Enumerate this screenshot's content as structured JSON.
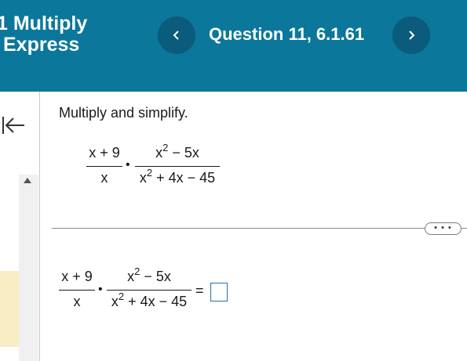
{
  "header": {
    "assignment_title_line1": "1 Multiply",
    "assignment_title_line2": "Express",
    "question_label": "Question 11, 6.1.61",
    "prev_icon": "chevron-left-icon",
    "next_icon": "chevron-right-icon"
  },
  "sidebar": {
    "collapse_icon": "collapse-left-icon"
  },
  "problem": {
    "instruction": "Multiply and simplify.",
    "expr": {
      "frac1_num": "x + 9",
      "frac1_den": "x",
      "dot": "•",
      "frac2_num_base": "x",
      "frac2_num_exp": "2",
      "frac2_num_rest": " − 5x",
      "frac2_den_base": "x",
      "frac2_den_exp": "2",
      "frac2_den_rest": " + 4x − 45"
    }
  },
  "more_button": {
    "label": "• • •"
  },
  "answer": {
    "equals": "=",
    "value": ""
  },
  "colors": {
    "header_bg": "#0b779a",
    "nav_button_bg": "#0a5b7c",
    "answer_box_border": "#1f6fb5",
    "highlight": "#f8ecc4"
  }
}
